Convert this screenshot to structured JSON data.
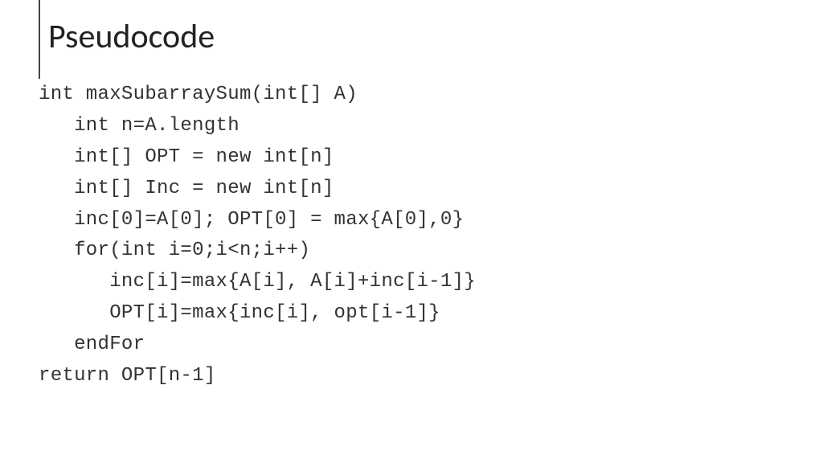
{
  "slide": {
    "title": "Pseudocode",
    "code": {
      "line1": "int maxSubarraySum(int[] A)",
      "line2": "   int n=A.length",
      "line3": "   int[] OPT = new int[n]",
      "line4": "   int[] Inc = new int[n]",
      "line5": "   inc[0]=A[0]; OPT[0] = max{A[0],0}",
      "line6": "   for(int i=0;i<n;i++)",
      "line7": "      inc[i]=max{A[i], A[i]+inc[i-1]}",
      "line8": "      OPT[i]=max{inc[i], opt[i-1]}",
      "line9": "   endFor",
      "line10": "return OPT[n-1]"
    }
  }
}
